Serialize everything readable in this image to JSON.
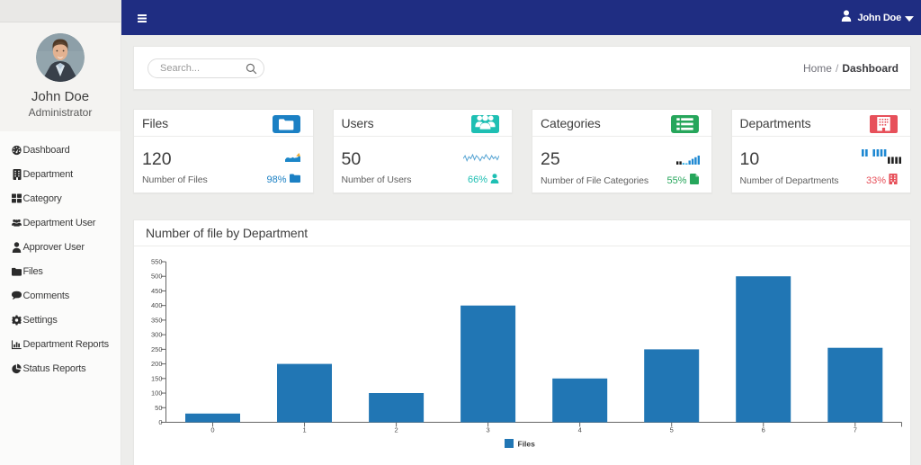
{
  "navbar": {
    "menu_icon": "bars-icon",
    "user": {
      "icon": "user-icon-white",
      "name": "John Doe",
      "caret_icon": "caret-down-icon"
    },
    "bg_color": "#1f2d82"
  },
  "sidebar": {
    "profile": {
      "name": "John Doe",
      "role": "Administrator",
      "avatar_icon": "avatar-photo"
    },
    "items": [
      {
        "label": "Dashboard",
        "icon": "dashboard-icon"
      },
      {
        "label": "Department",
        "icon": "building-icon"
      },
      {
        "label": "Category",
        "icon": "th-large-icon"
      },
      {
        "label": "Department User",
        "icon": "users-icon"
      },
      {
        "label": "Approver User",
        "icon": "person-icon"
      },
      {
        "label": "Files",
        "icon": "folder-icon"
      },
      {
        "label": "Comments",
        "icon": "comment-icon"
      },
      {
        "label": "Settings",
        "icon": "gear-icon"
      },
      {
        "label": "Department Reports",
        "icon": "bar-chart-icon"
      },
      {
        "label": "Status Reports",
        "icon": "pie-chart-icon"
      }
    ]
  },
  "topbar": {
    "search": {
      "placeholder": "Search...",
      "icon": "search-icon"
    },
    "breadcrumb": {
      "home": "Home",
      "separator": "/",
      "current": "Dashboard"
    }
  },
  "stats": [
    {
      "title": "Files",
      "chip_icon": "folder-chip-icon",
      "color": "#1b80c4",
      "value": "120",
      "label": "Number of Files",
      "percent": "98%",
      "percent_icon": "folder-mini-icon",
      "spark": {
        "type": "area",
        "values": [
          4,
          6.5,
          7,
          6,
          6,
          7.5,
          6,
          6.5,
          7,
          9,
          8
        ],
        "color": "#1b86c8",
        "accent": "#f0a92e"
      }
    },
    {
      "title": "Users",
      "chip_icon": "users-chip-icon",
      "color": "#1ebfb3",
      "value": "50",
      "label": "Number of Users",
      "percent": "66%",
      "percent_icon": "person-mini-icon",
      "spark": {
        "type": "line",
        "values": [
          5,
          8,
          3,
          7,
          5,
          9,
          4,
          8,
          6,
          3,
          7,
          5,
          9,
          6,
          4,
          8,
          5,
          7,
          4,
          8
        ],
        "color": "#56a4d3"
      }
    },
    {
      "title": "Categories",
      "chip_icon": "list-chip-icon",
      "color": "#26a65b",
      "value": "25",
      "label": "Number of File Categories",
      "percent": "55%",
      "percent_icon": "file-mini-icon",
      "spark": {
        "type": "bars",
        "values": [
          4,
          4,
          2,
          1,
          5,
          7,
          9,
          11
        ],
        "colors": [
          "#1f1f1f",
          "#1f1f1f",
          "#31b0e8",
          "#31b0e8",
          "#1e88d2",
          "#1e88d2",
          "#1e88d2",
          "#1e88d2"
        ]
      }
    },
    {
      "title": "Departments",
      "chip_icon": "building-chip-icon",
      "color": "#e7505a",
      "value": "10",
      "label": "Number of Departments",
      "percent": "33%",
      "percent_icon": "building-mini-icon",
      "spark": {
        "type": "winloss",
        "values": [
          1,
          1,
          0,
          1,
          1,
          1,
          1,
          -1,
          -1,
          -1,
          -1
        ],
        "pos_color": "#1e88d2",
        "neg_color": "#1f1f1f"
      }
    }
  ],
  "chart_card": {
    "title": "Number of file by Department"
  },
  "chart_data": {
    "type": "bar",
    "title": "Number of file by Department",
    "categories": [
      "0",
      "1",
      "2",
      "3",
      "4",
      "5",
      "6",
      "7"
    ],
    "series": [
      {
        "name": "Files",
        "values": [
          30,
          200,
          100,
          400,
          150,
          250,
          500,
          255
        ],
        "color": "#2176b4"
      }
    ],
    "xlabel": "",
    "ylabel": "",
    "ylim": [
      0,
      550
    ],
    "ytick_step": 50,
    "grid": false,
    "legend": {
      "position": "bottom",
      "labels": [
        "Files"
      ]
    },
    "axis_color": "#666666",
    "tick_label_color": "#4a4a4a"
  }
}
